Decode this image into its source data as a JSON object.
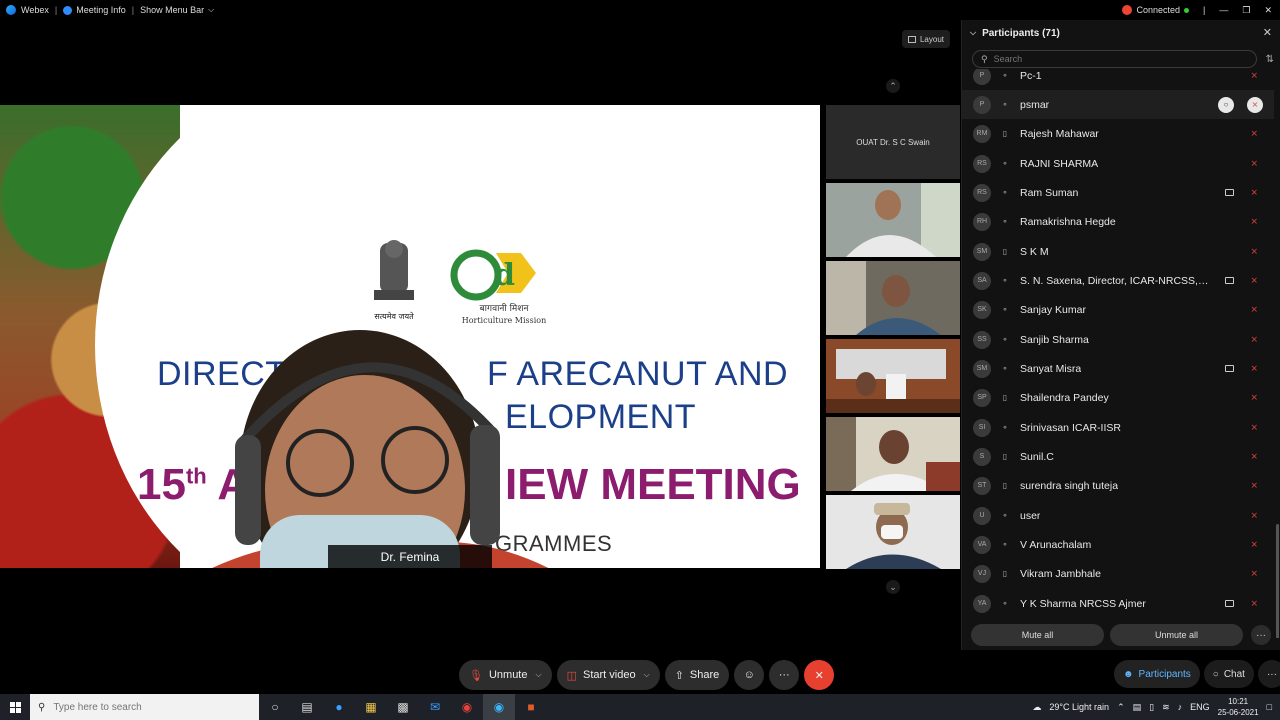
{
  "topbar": {
    "app_name": "Webex",
    "meeting_info": "Meeting Info",
    "show_menu_bar": "Show Menu Bar",
    "status": "Connected",
    "layout_label": "Layout"
  },
  "slide": {
    "line1": "DIRECT",
    "line1b": "F ARECANUT AND",
    "line2": "ELOPMENT",
    "line3_num": "15",
    "line3_sup": "th",
    "line3_a": "A",
    "line3_b": "IEW MEETING",
    "line4": "GRAMMES",
    "emblem_caption": "सत्यमेव जयते",
    "logo_hindi": "बागवानी मिशन",
    "logo_english": "Horticulture Mission",
    "logo_mark": "d",
    "speaker_name": "Dr. Femina"
  },
  "thumbnails": [
    {
      "label": "OUAT Dr. S C Swain"
    },
    {
      "label": ""
    },
    {
      "label": ""
    },
    {
      "label": ""
    },
    {
      "label": ""
    },
    {
      "label": ""
    }
  ],
  "participants": {
    "title": "Participants (71)",
    "search_placeholder": "Search",
    "items": [
      {
        "initials": "P",
        "name": "Pc-1",
        "device": "audio",
        "video": false
      },
      {
        "initials": "P",
        "name": "psmar",
        "device": "audio",
        "video": false,
        "highlighted": true
      },
      {
        "initials": "RM",
        "name": "Rajesh Mahawar",
        "device": "phone",
        "video": false
      },
      {
        "initials": "RS",
        "name": "RAJNI SHARMA",
        "device": "audio",
        "video": false
      },
      {
        "initials": "RS",
        "name": "Ram Suman",
        "device": "audio",
        "video": true
      },
      {
        "initials": "RH",
        "name": "Ramakrishna Hegde",
        "device": "audio",
        "video": false
      },
      {
        "initials": "SM",
        "name": "S K M",
        "device": "phone",
        "video": false
      },
      {
        "initials": "SA",
        "name": "S. N. Saxena, Director, ICAR-NRCSS, Aj...",
        "device": "audio",
        "video": true
      },
      {
        "initials": "SK",
        "name": "Sanjay Kumar",
        "device": "audio",
        "video": false
      },
      {
        "initials": "SS",
        "name": "Sanjib Sharma",
        "device": "audio",
        "video": false
      },
      {
        "initials": "SM",
        "name": "Sanyat Misra",
        "device": "audio",
        "video": true
      },
      {
        "initials": "SP",
        "name": "Shailendra Pandey",
        "device": "phone",
        "video": false
      },
      {
        "initials": "SI",
        "name": "Srinivasan ICAR-IISR",
        "device": "audio",
        "video": false
      },
      {
        "initials": "S",
        "name": "Sunil.C",
        "device": "phone",
        "video": false
      },
      {
        "initials": "ST",
        "name": "surendra singh tuteja",
        "device": "phone",
        "video": false
      },
      {
        "initials": "U",
        "name": "user",
        "device": "audio",
        "video": false
      },
      {
        "initials": "VA",
        "name": "V Arunachalam",
        "device": "audio",
        "video": false
      },
      {
        "initials": "VJ",
        "name": "Vikram Jambhale",
        "device": "phone",
        "video": false
      },
      {
        "initials": "YA",
        "name": "Y K Sharma NRCSS Ajmer",
        "device": "audio",
        "video": true
      }
    ],
    "mute_all": "Mute all",
    "unmute_all": "Unmute all"
  },
  "controls": {
    "unmute": "Unmute",
    "start_video": "Start video",
    "share": "Share",
    "more": "···",
    "end": "✕",
    "participants_tab": "Participants",
    "chat_tab": "Chat"
  },
  "taskbar": {
    "search_placeholder": "Type here to search",
    "weather": "29°C  Light rain",
    "lang": "ENG",
    "time": "10:21",
    "date": "25-06-2021"
  },
  "colors": {
    "accent_blue": "#5fb6ff",
    "mute_red": "#e0443b",
    "end_red": "#e8402f",
    "slide_blue": "#1c3f8a",
    "slide_purple": "#8c1c6e"
  }
}
